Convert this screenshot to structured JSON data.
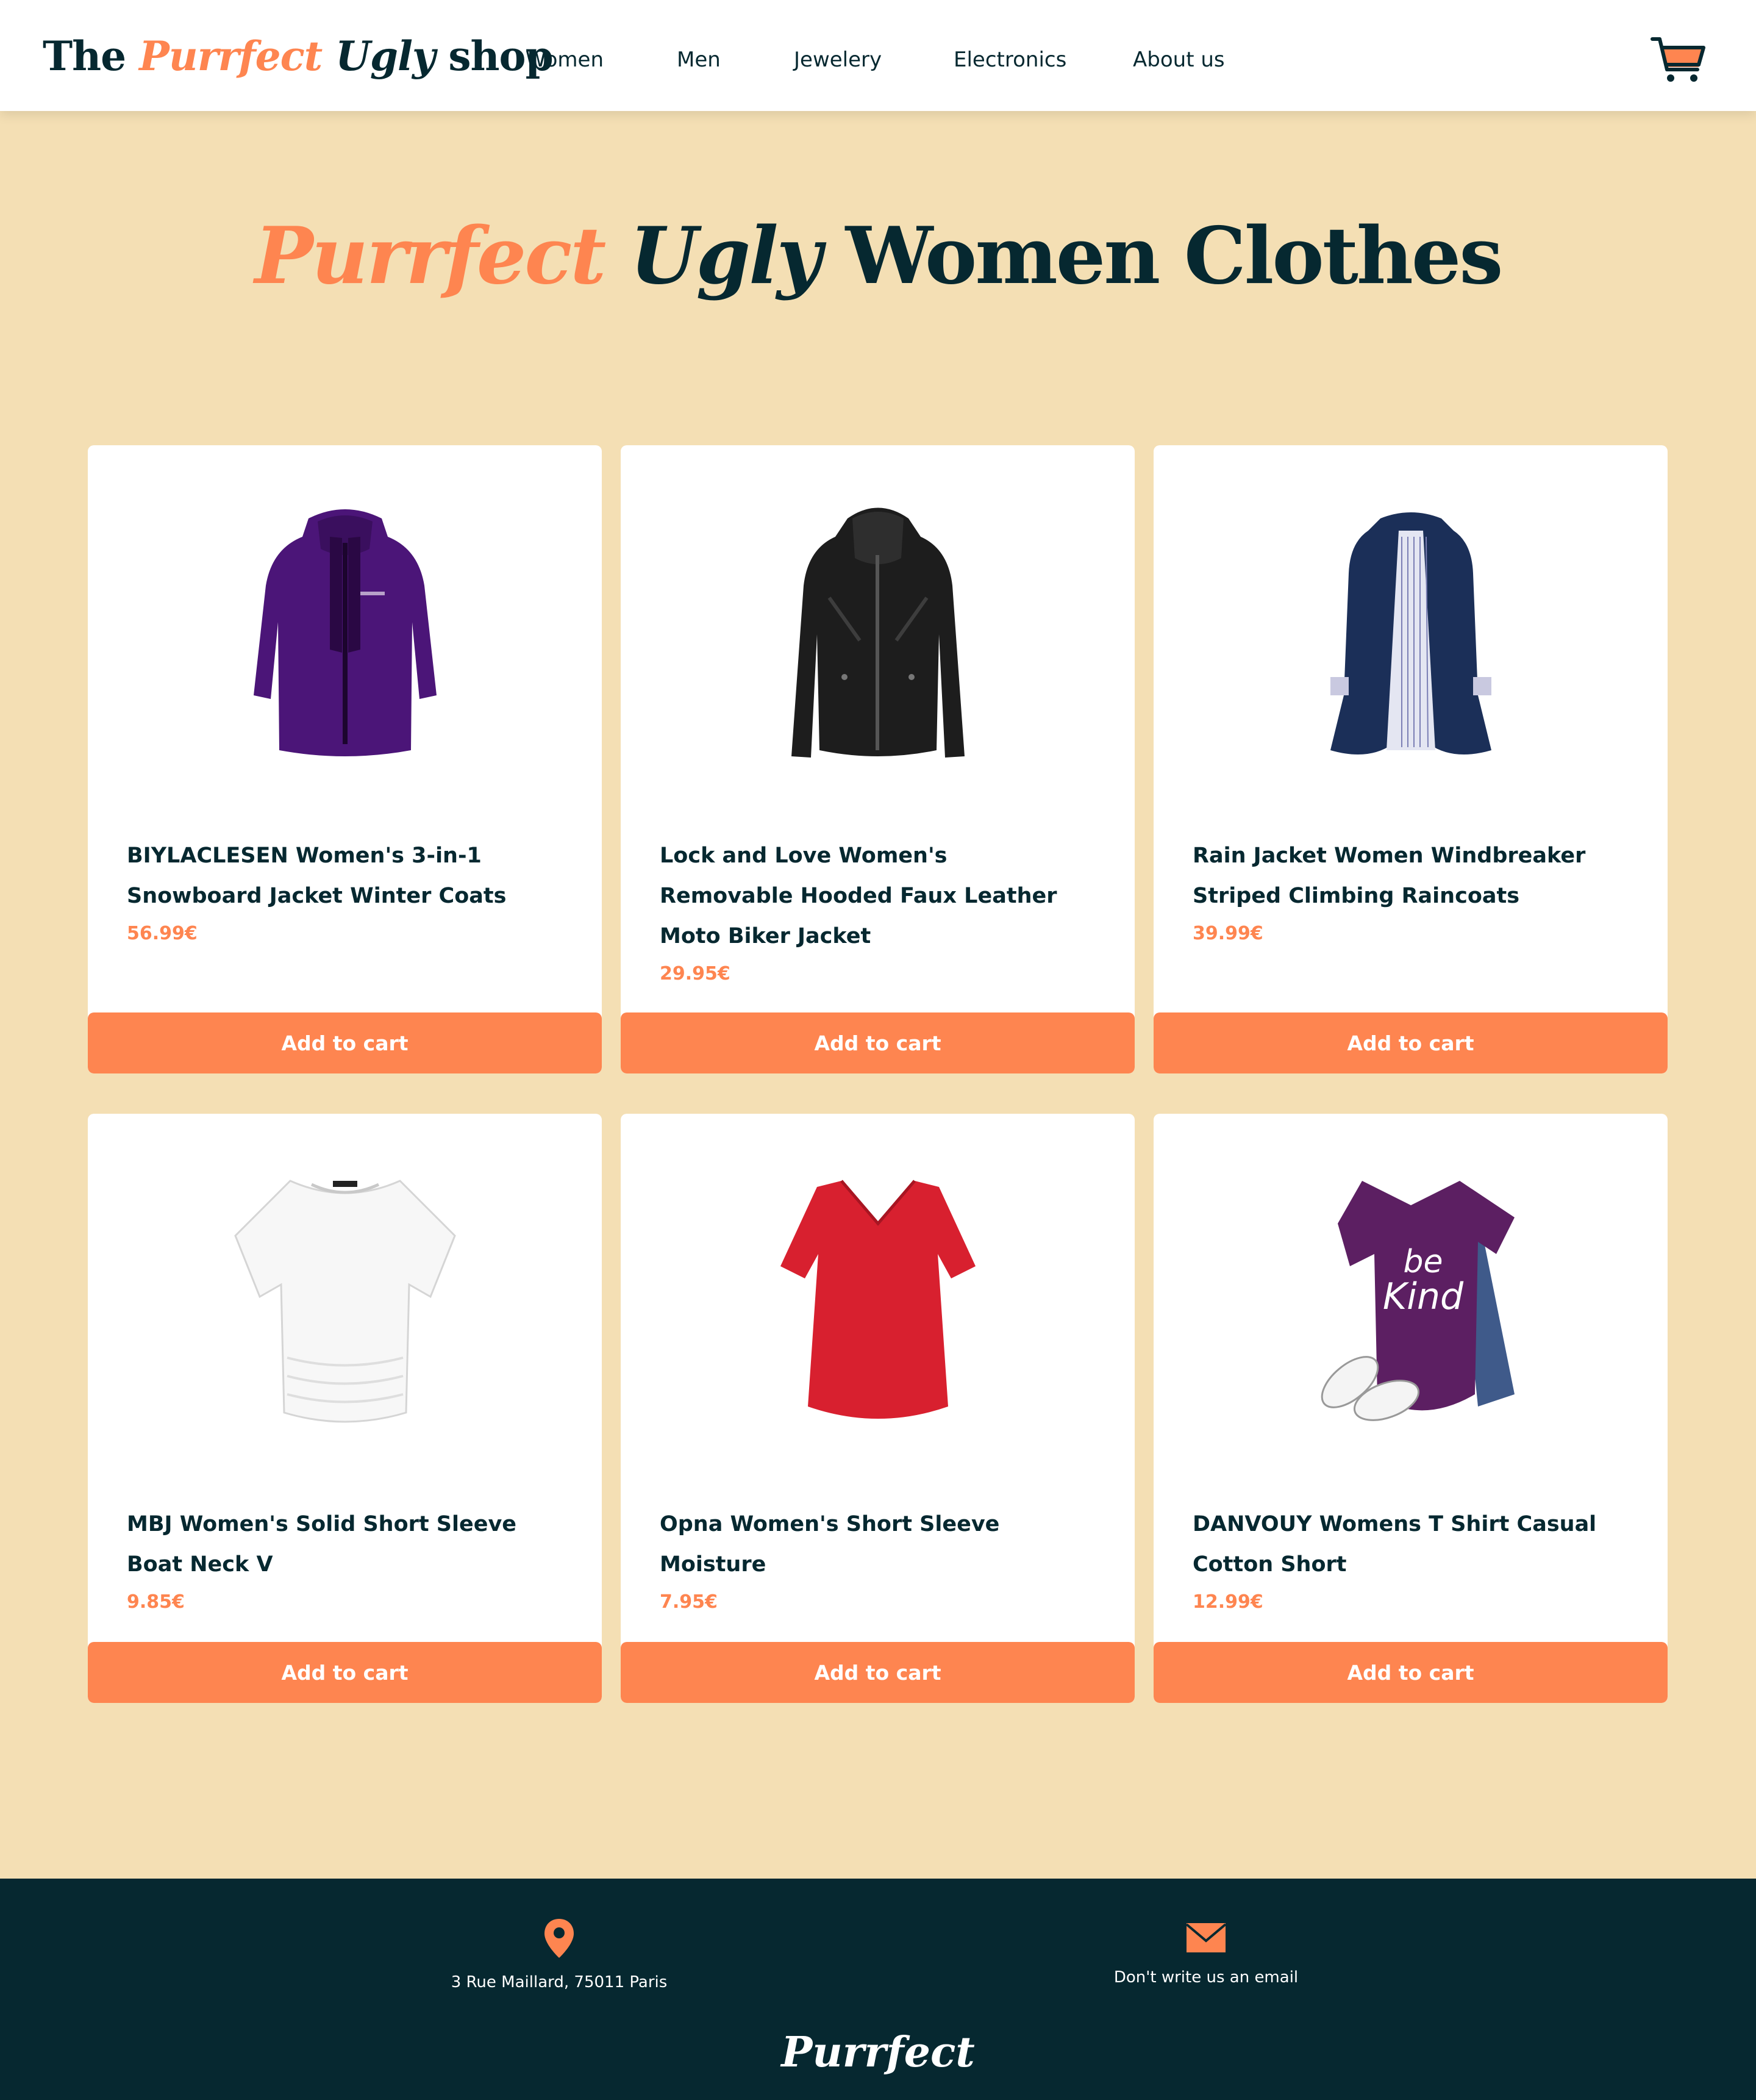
{
  "header": {
    "logo": {
      "part1": "The ",
      "part2": "Purrfect",
      "part3": " ",
      "part4": "Ugly",
      "part5": " shop"
    },
    "nav": [
      "Women",
      "Men",
      "Jewelery",
      "Electronics",
      "About us"
    ],
    "cart_icon": "shopping-cart-icon"
  },
  "title": {
    "accent": "Purrfect",
    "ugly": "Ugly",
    "rest": "Women Clothes"
  },
  "products": [
    {
      "name": "BIYLACLESEN Women's 3-in-1 Snowboard Jacket Winter Coats",
      "price": "56.99€",
      "button": "Add to cart",
      "image": "purple-jacket-image"
    },
    {
      "name": "Lock and Love Women's Removable Hooded Faux Leather Moto Biker Jacket",
      "price": "29.95€",
      "button": "Add to cart",
      "image": "black-leather-jacket-image"
    },
    {
      "name": "Rain Jacket Women Windbreaker Striped Climbing Raincoats",
      "price": "39.99€",
      "button": "Add to cart",
      "image": "navy-raincoat-image"
    },
    {
      "name": "MBJ Women's Solid Short Sleeve Boat Neck V",
      "price": "9.85€",
      "button": "Add to cart",
      "image": "white-tshirt-image"
    },
    {
      "name": "Opna Women's Short Sleeve Moisture",
      "price": "7.95€",
      "button": "Add to cart",
      "image": "red-tshirt-image"
    },
    {
      "name": "DANVOUY Womens T Shirt Casual Cotton Short",
      "price": "12.99€",
      "button": "Add to cart",
      "image": "purple-be-kind-tshirt-image"
    }
  ],
  "footer": {
    "address": "3 Rue Maillard, 75011 Paris",
    "address_icon": "location-pin-icon",
    "email": "Don't write us an email",
    "email_icon": "envelope-icon",
    "brand": "Purrfect"
  },
  "colors": {
    "accent": "#fe8550",
    "dark": "#062830",
    "background": "#f4dfb4",
    "card": "#ffffff"
  }
}
